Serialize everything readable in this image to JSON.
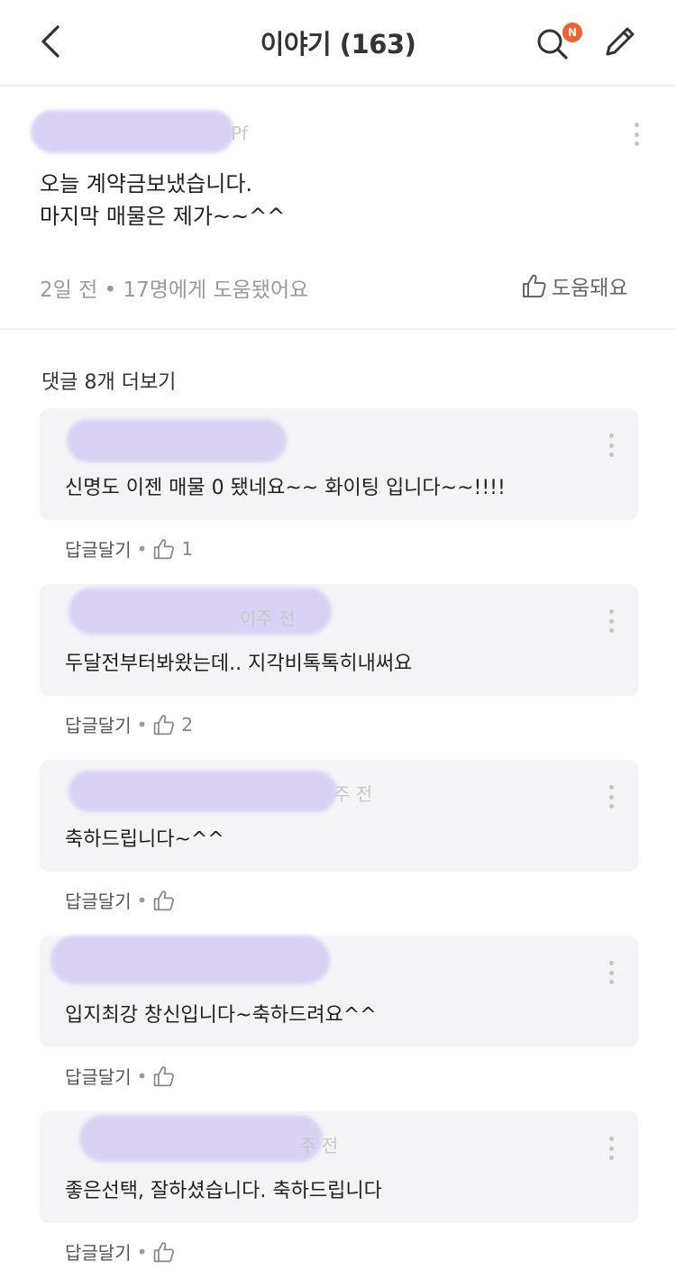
{
  "header": {
    "title": "이야기 (163)",
    "notification_badge": "N",
    "badge_color": "#f0622f"
  },
  "post": {
    "author_tail": "Pf",
    "body_lines": [
      "오늘 계약금보냈습니다.",
      "마지막 매물은 제가~~^^"
    ],
    "meta": "2일 전 • 17명에게 도움됐어요",
    "helpful_label": "도움돼요"
  },
  "comments_more_label": "댓글 8개 더보기",
  "comments": [
    {
      "meta_tail": "",
      "text": "신명도 이젠 매물 0 됐네요~~  화이팅 입니다~~!!!!",
      "reply_label": "답글달기",
      "likes": "1"
    },
    {
      "meta_tail": "이주 전",
      "text": "두달전부터봐왔는데.. 지각비톡톡히내써요",
      "reply_label": "답글달기",
      "likes": "2"
    },
    {
      "meta_tail": "주 전",
      "text": "축하드립니다~^^",
      "reply_label": "답글달기",
      "likes": ""
    },
    {
      "meta_tail": "",
      "text": "입지최강 창신입니다~축하드려요^^",
      "reply_label": "답글달기",
      "likes": ""
    },
    {
      "meta_tail": "주 전",
      "text": "좋은선택, 잘하셨습니다. 축하드립니다",
      "reply_label": "답글달기",
      "likes": ""
    }
  ]
}
